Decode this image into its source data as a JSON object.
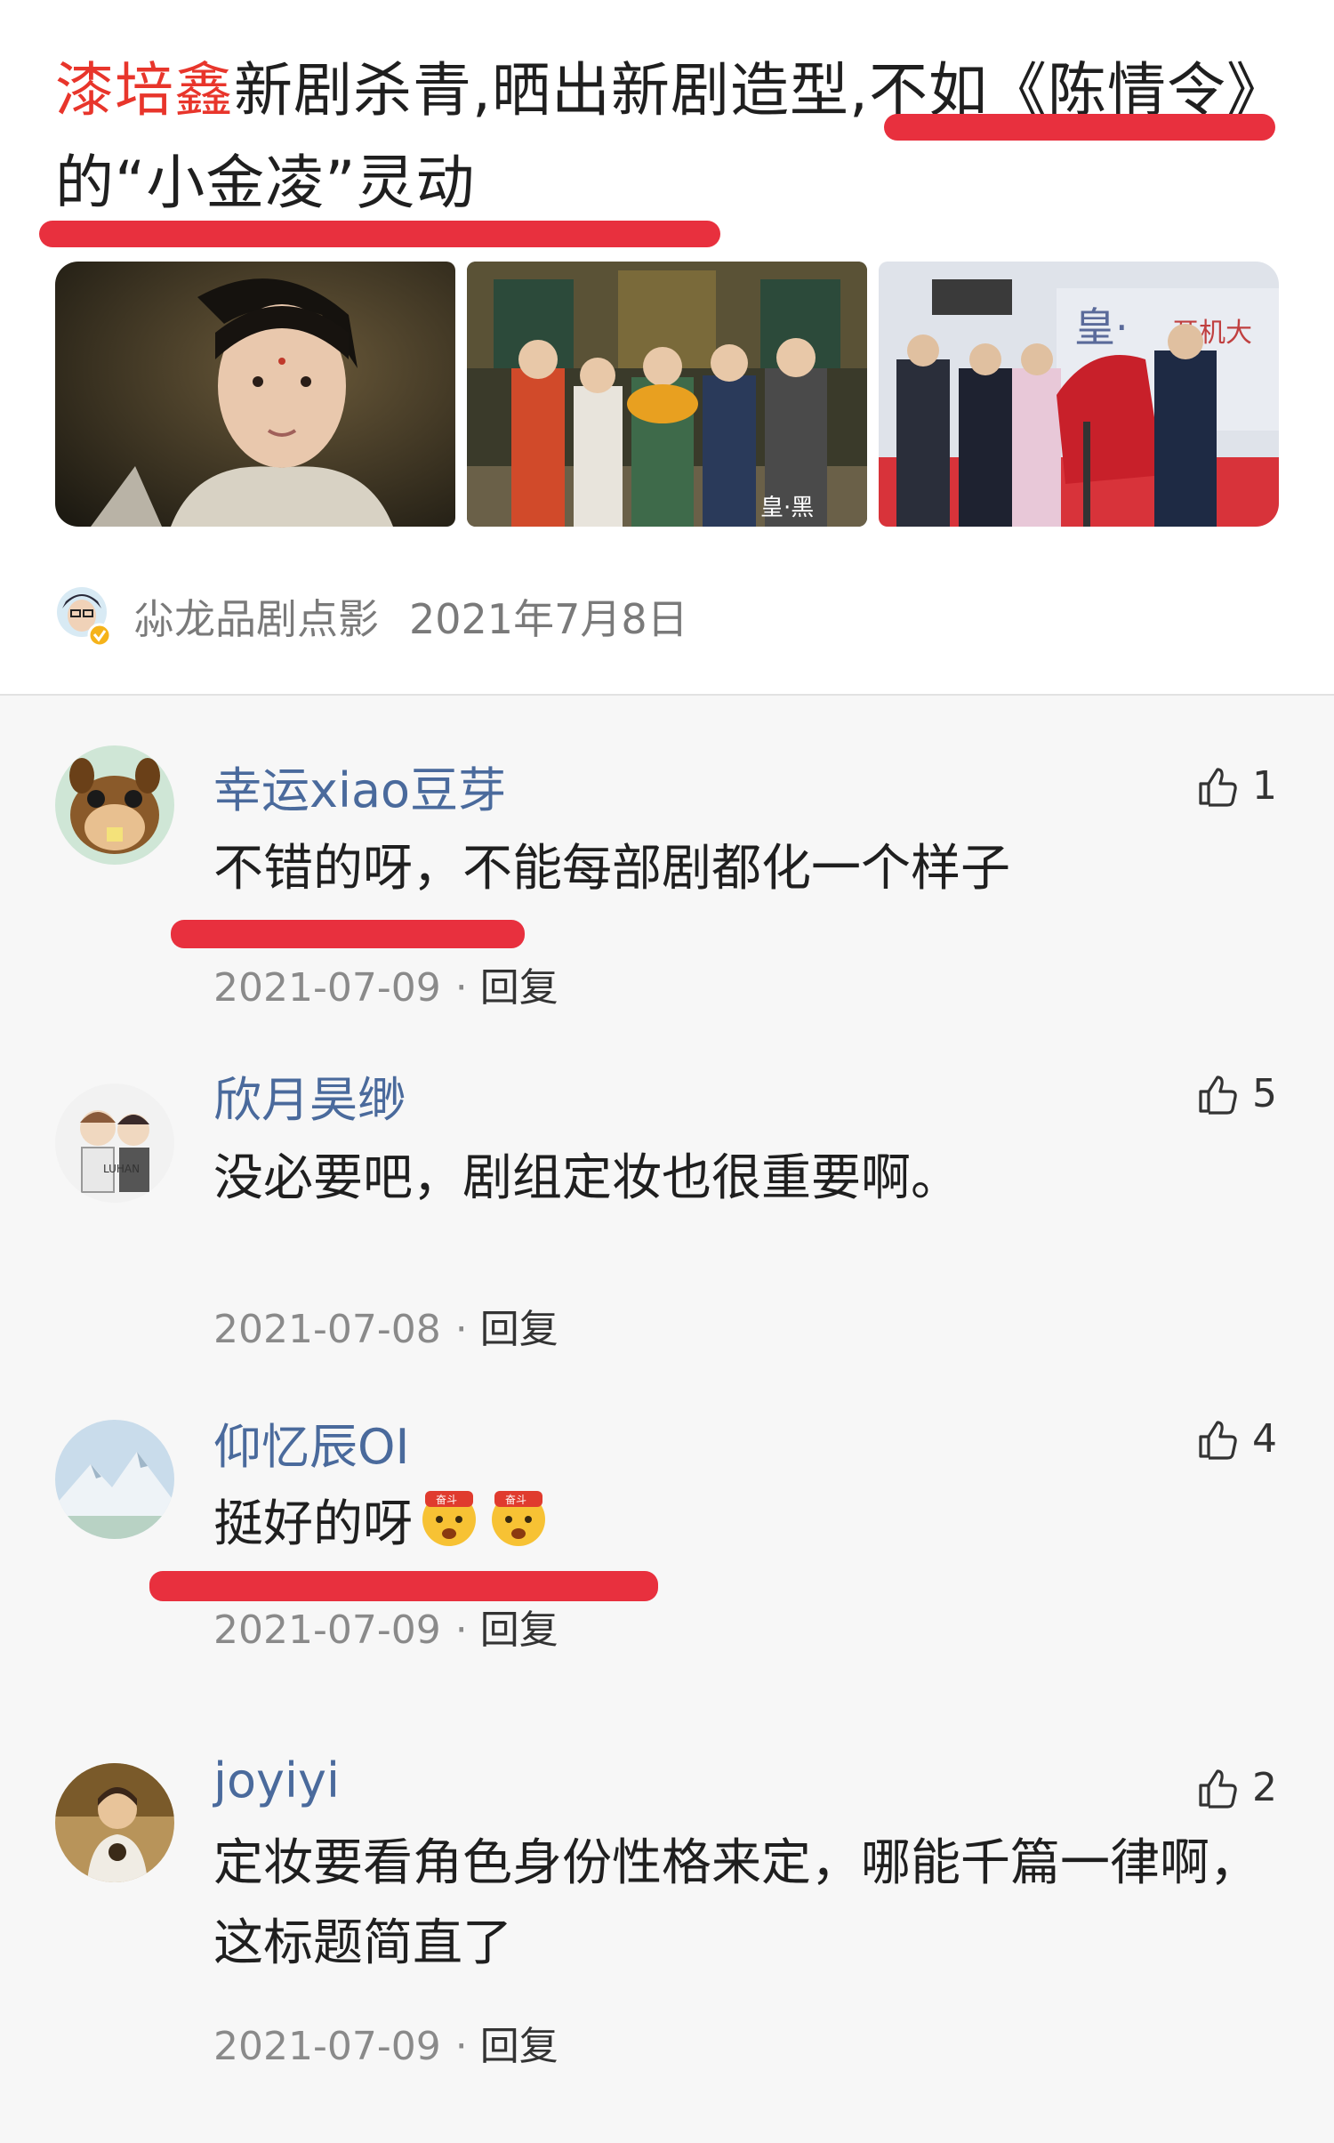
{
  "article": {
    "title_highlight": "漆培鑫",
    "title_rest": "新剧杀青,晒出新剧造型,不如《陈情令》的“小金凌”灵动",
    "author": "尛龙品剧点影",
    "date": "2021年7月8日",
    "thumbnails": [
      "portrait-icon",
      "group-photo-icon",
      "crew-photo-icon"
    ]
  },
  "comments": [
    {
      "user": "幸运xiao豆芽",
      "text": "不错的呀，不能每部剧都化一个样子",
      "date": "2021-07-09",
      "reply": "回复",
      "likes": "1"
    },
    {
      "user": "欣月昊缈",
      "text": "没必要吧，剧组定妆也很重要啊。",
      "date": "2021-07-08",
      "reply": "回复",
      "likes": "5"
    },
    {
      "user": "仰忆辰OI",
      "text": "挺好的呀",
      "date": "2021-07-09",
      "reply": "回复",
      "likes": "4",
      "emojis": [
        "struggle-emoji",
        "struggle-emoji"
      ]
    },
    {
      "user": "joyiyi",
      "text": "定妆要看角色身份性格来定，哪能千篇一律啊，这标题简直了",
      "date": "2021-07-09",
      "reply": "回复",
      "likes": "2"
    }
  ],
  "colors": {
    "highlight_red": "#e8352b",
    "underline_red": "#e8303e",
    "username_blue": "#4a6a9c"
  }
}
